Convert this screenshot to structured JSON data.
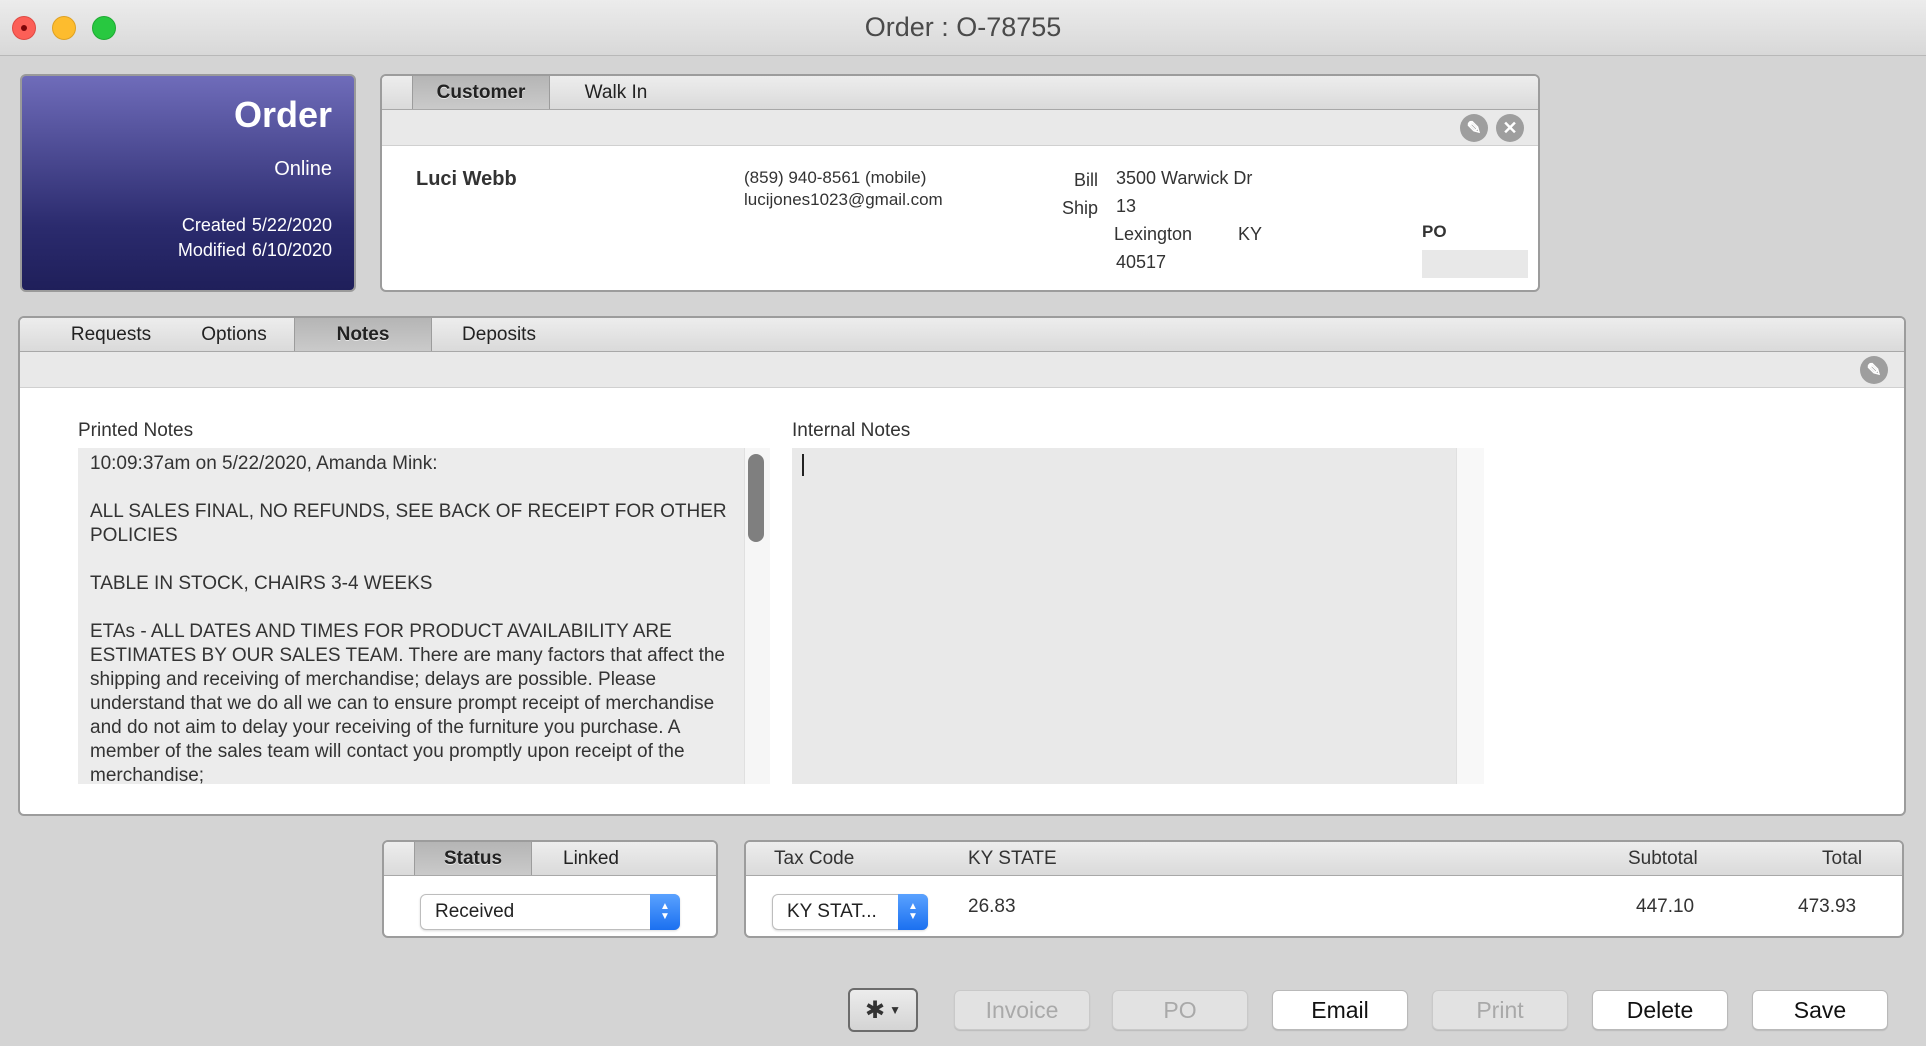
{
  "window": {
    "title": "Order : O-78755"
  },
  "order": {
    "title": "Order",
    "source": "Online",
    "created_label": "Created",
    "created": "5/22/2020",
    "modified_label": "Modified",
    "modified": "6/10/2020"
  },
  "customer": {
    "tabs": [
      "Customer",
      "Walk In"
    ],
    "name": "Luci Webb",
    "phone": "(859) 940-8561 (mobile)",
    "email": "lucijones1023@gmail.com",
    "bill_label": "Bill",
    "ship_label": "Ship",
    "address1": "3500 Warwick Dr",
    "address2": "13",
    "city": "Lexington",
    "state": "KY",
    "zip": "40517",
    "po_label": "PO",
    "po_value": ""
  },
  "notes": {
    "tabs": [
      "Requests",
      "Options",
      "Notes",
      "Deposits"
    ],
    "printed_label": "Printed Notes",
    "internal_label": "Internal Notes",
    "printed_text": "10:09:37am on 5/22/2020, Amanda Mink:\n\nALL SALES FINAL, NO REFUNDS, SEE BACK OF RECEIPT FOR OTHER POLICIES\n\nTABLE IN STOCK, CHAIRS 3-4 WEEKS\n\nETAs - ALL DATES AND TIMES FOR PRODUCT AVAILABILITY ARE ESTIMATES BY OUR SALES TEAM. There are many factors that affect the shipping and receiving of merchandise; delays are possible. Please understand that we do all we can to ensure prompt receipt of merchandise and do not aim to delay your receiving of the furniture you purchase. A member of the sales team will contact you promptly upon receipt of the merchandise;",
    "internal_text": ""
  },
  "status": {
    "tabs": [
      "Status",
      "Linked"
    ],
    "value": "Received"
  },
  "totals": {
    "tax_code_label": "Tax Code",
    "tax_name": "KY STATE",
    "subtotal_label": "Subtotal",
    "total_label": "Total",
    "tax_code_value": "KY STAT...",
    "tax_amount": "26.83",
    "subtotal": "447.10",
    "total": "473.93"
  },
  "buttons": {
    "invoice": "Invoice",
    "po": "PO",
    "email": "Email",
    "print": "Print",
    "delete": "Delete",
    "save": "Save"
  }
}
